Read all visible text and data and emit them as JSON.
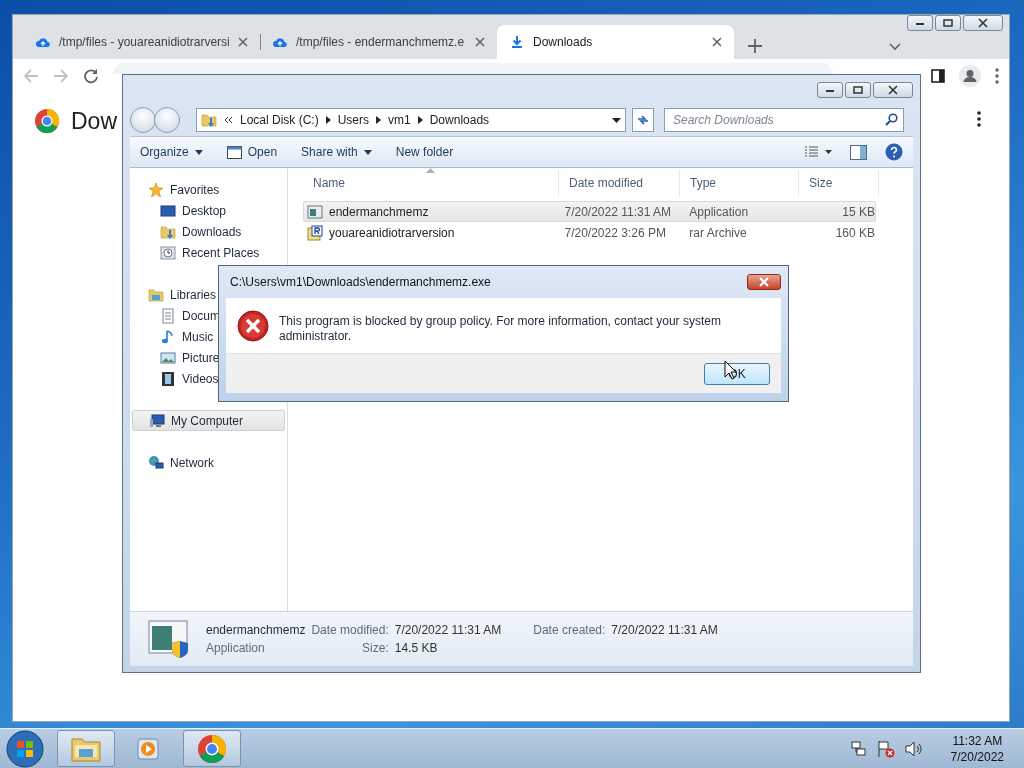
{
  "browser": {
    "tabs": [
      {
        "label": "/tmp/files - youareanidiotrarversi",
        "kind": "cloud",
        "selected": false
      },
      {
        "label": "/tmp/files - endermanchmemz.e",
        "kind": "cloud",
        "selected": false
      },
      {
        "label": "Downloads",
        "kind": "download",
        "selected": true
      }
    ],
    "page_title": "Dow"
  },
  "explorer": {
    "breadcrumb": [
      "Local Disk (C:)",
      "Users",
      "vm1",
      "Downloads"
    ],
    "search": {
      "placeholder": "Search Downloads"
    },
    "toolbar": [
      {
        "label": "Organize",
        "kind": "menu"
      },
      {
        "label": "Open",
        "kind": "open"
      },
      {
        "label": "Share with",
        "kind": "menu"
      },
      {
        "label": "New folder",
        "kind": "plain"
      }
    ],
    "nav": [
      {
        "label": "Favorites",
        "kind": "star",
        "selected": false,
        "children": [
          {
            "label": "Desktop",
            "kind": "desktop",
            "selected": false
          },
          {
            "label": "Downloads",
            "kind": "downloads",
            "selected": false
          },
          {
            "label": "Recent Places",
            "kind": "recent",
            "selected": false
          }
        ]
      },
      {
        "label": "Libraries",
        "kind": "libraries",
        "selected": false,
        "children": [
          {
            "label": "Docum",
            "kind": "documents",
            "selected": false
          },
          {
            "label": "Music",
            "kind": "music",
            "selected": false
          },
          {
            "label": "Picture",
            "kind": "pictures",
            "selected": false
          },
          {
            "label": "Videos",
            "kind": "videos",
            "selected": false
          }
        ]
      },
      {
        "label": "My Computer",
        "kind": "computer",
        "selected": true
      },
      {
        "label": "Network",
        "kind": "network",
        "selected": false
      }
    ],
    "columns": [
      "Name",
      "Date modified",
      "Type",
      "Size"
    ],
    "files": [
      {
        "name": "endermanchmemz",
        "date": "7/20/2022 11:31 AM",
        "type": "Application",
        "size": "15 KB",
        "kind": "app",
        "selected": true
      },
      {
        "name": "youareanidiotrarversion",
        "date": "7/20/2022 3:26 PM",
        "type": "rar Archive",
        "size": "160 KB",
        "kind": "rar",
        "selected": false
      }
    ],
    "details": {
      "name": "endermanchmemz",
      "type": "Application",
      "fields": [
        {
          "label": "Date modified:",
          "value": "7/20/2022 11:31 AM"
        },
        {
          "label": "Date created:",
          "value": "7/20/2022 11:31 AM"
        },
        {
          "label": "Size:",
          "value": "14.5 KB"
        }
      ]
    }
  },
  "dialog": {
    "title": "C:\\Users\\vm1\\Downloads\\endermanchmemz.exe",
    "message": "This program is blocked by group policy. For more information, contact your system administrator.",
    "button": "OK"
  },
  "taskbar": {
    "apps": [
      {
        "kind": "folder",
        "running": true
      },
      {
        "kind": "player",
        "running": false
      },
      {
        "kind": "chrome",
        "running": true
      }
    ],
    "time": "11:32 AM",
    "date": "7/20/2022"
  }
}
